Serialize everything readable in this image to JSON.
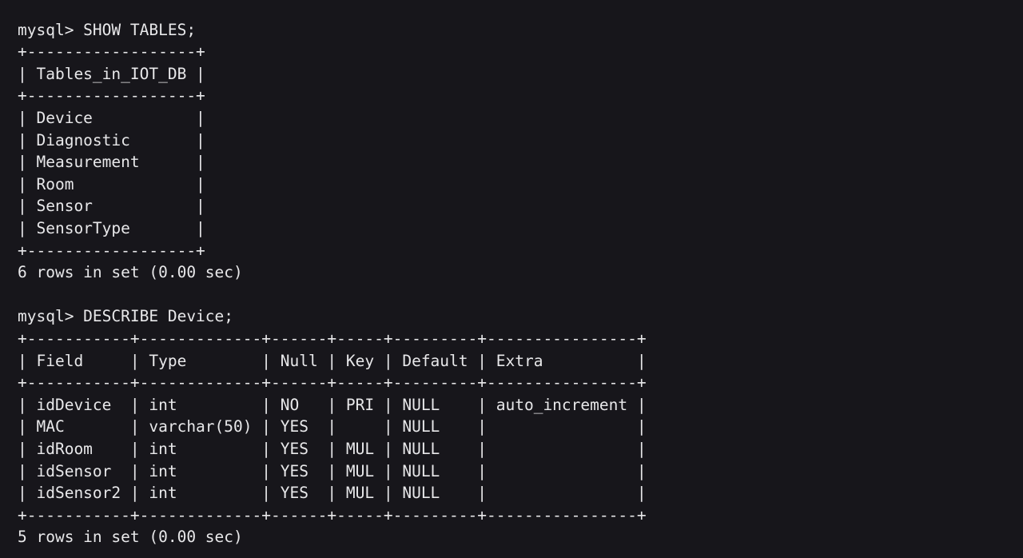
{
  "terminal": {
    "lines": [
      "mysql> SHOW TABLES;",
      "+------------------+",
      "| Tables_in_IOT_DB |",
      "+------------------+",
      "| Device           |",
      "| Diagnostic       |",
      "| Measurement      |",
      "| Room             |",
      "| Sensor           |",
      "| SensorType       |",
      "+------------------+",
      "6 rows in set (0.00 sec)",
      "",
      "mysql> DESCRIBE Device;",
      "+-----------+-------------+------+-----+---------+----------------+",
      "| Field     | Type        | Null | Key | Default | Extra          |",
      "+-----------+-------------+------+-----+---------+----------------+",
      "| idDevice  | int         | NO   | PRI | NULL    | auto_increment |",
      "| MAC       | varchar(50) | YES  |     | NULL    |                |",
      "| idRoom    | int         | YES  | MUL | NULL    |                |",
      "| idSensor  | int         | YES  | MUL | NULL    |                |",
      "| idSensor2 | int         | YES  | MUL | NULL    |                |",
      "+-----------+-------------+------+-----+---------+----------------+",
      "5 rows in set (0.00 sec)"
    ]
  }
}
